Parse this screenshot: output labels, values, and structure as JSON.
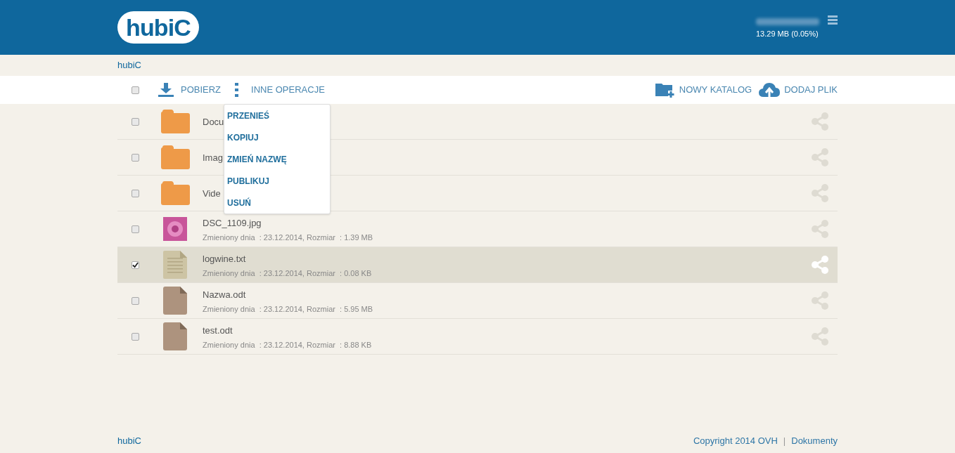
{
  "header": {
    "logo": "hubiC",
    "quota": "13.29 MB (0.05%)"
  },
  "breadcrumb": "hubiC",
  "toolbar": {
    "select_all": {
      "checked": false
    },
    "download": "POBIERZ",
    "more": "INNE OPERACJE",
    "new_folder": "NOWY KATALOG",
    "add_file": "DODAJ PLIK"
  },
  "menu": {
    "expanded": true,
    "items": [
      "PRZENIEŚ",
      "KOPIUJ",
      "ZMIEŃ NAZWĘ",
      "PUBLIKUJ",
      "USUŃ"
    ]
  },
  "files": [
    {
      "kind": "folder",
      "name": "Docu",
      "checked": false,
      "selected": false
    },
    {
      "kind": "folder",
      "name": "Imag",
      "checked": false,
      "selected": false
    },
    {
      "kind": "folder",
      "name": "Vide",
      "checked": false,
      "selected": false
    },
    {
      "kind": "image",
      "name": "DSC_1109.jpg",
      "details": "Zmieniony dnia  : 23.12.2014, Rozmiar  : 1.39 MB",
      "checked": false,
      "selected": false
    },
    {
      "kind": "text",
      "name": "logwine.txt",
      "details": "Zmieniony dnia  : 23.12.2014, Rozmiar  : 0.08 KB",
      "checked": true,
      "selected": true
    },
    {
      "kind": "document",
      "name": "Nazwa.odt",
      "details": "Zmieniony dnia  : 23.12.2014, Rozmiar  : 5.95 MB",
      "checked": false,
      "selected": false
    },
    {
      "kind": "document",
      "name": "test.odt",
      "details": "Zmieniony dnia  : 23.12.2014, Rozmiar  : 8.88 KB",
      "checked": false,
      "selected": false
    }
  ],
  "footer": {
    "brand": "hubiC",
    "copyright": "Copyright 2014 OVH",
    "separator": "|",
    "docs": "Dokumenty"
  }
}
